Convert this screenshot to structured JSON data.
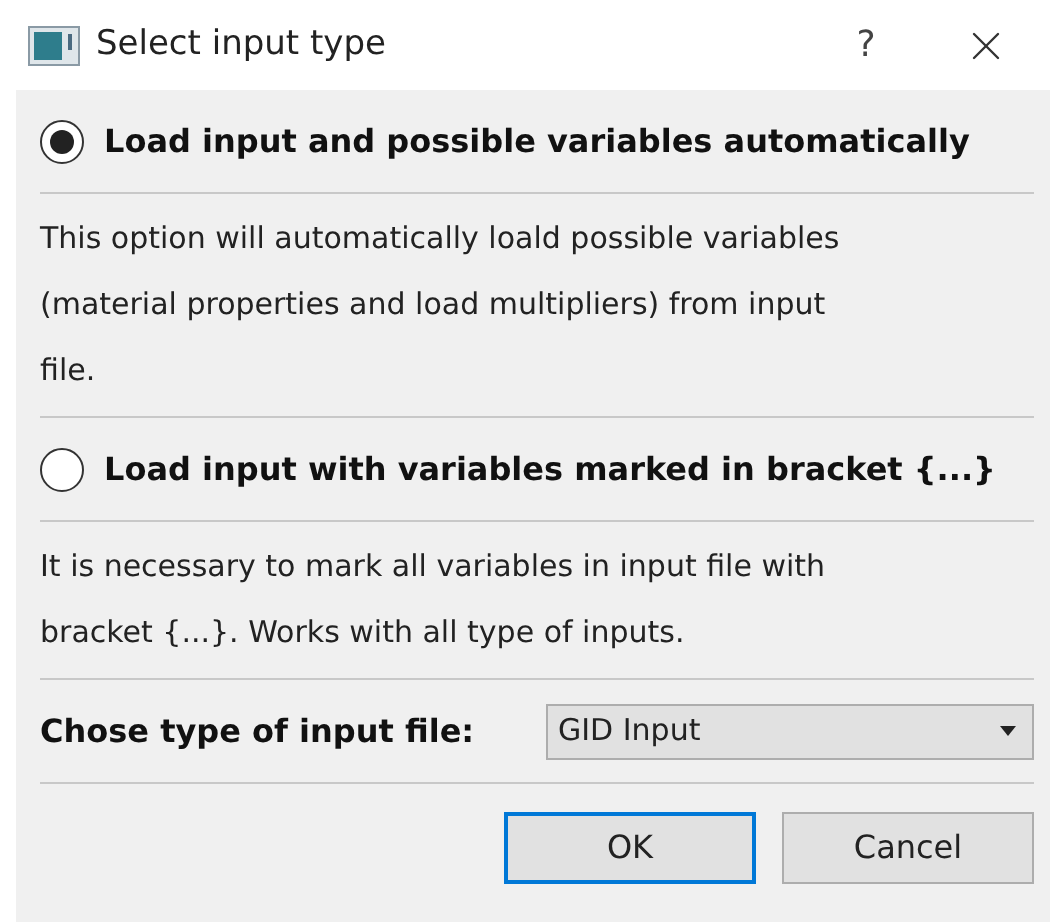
{
  "window": {
    "title": "Select input type",
    "help": "?"
  },
  "options": [
    {
      "label": "Load input and possible variables automatically",
      "selected": true,
      "description_lines": [
        "This option will automatically loald possible variables",
        "(material properties and load multipliers) from input",
        "file."
      ]
    },
    {
      "label": "Load input with variables marked in bracket {...}",
      "selected": false,
      "description_lines": [
        "It is necessary to mark all variables in input file with",
        "bracket {...}. Works with all type of inputs."
      ]
    }
  ],
  "file_type": {
    "label": "Chose type of input file:",
    "value": "GID Input"
  },
  "buttons": [
    {
      "label": "OK",
      "default": true
    },
    {
      "label": "Cancel",
      "default": false
    }
  ]
}
